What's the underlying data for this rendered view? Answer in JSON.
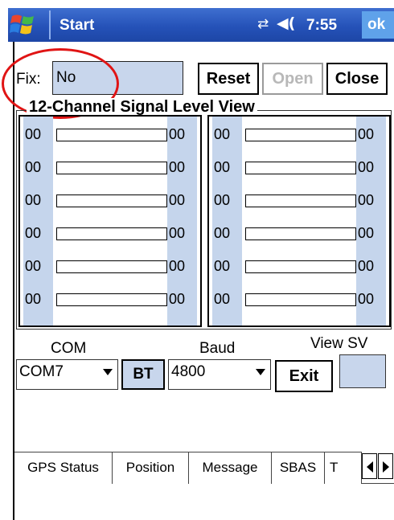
{
  "titlebar": {
    "title": "Start",
    "time": "7:55",
    "ok_label": "ok",
    "connectivity_icon": "connectivity-icon",
    "volume_icon": "volume-icon",
    "logo_icon": "windows-flag-icon"
  },
  "fix": {
    "label": "Fix:",
    "value": "No"
  },
  "buttons": {
    "reset": "Reset",
    "open": "Open",
    "close": "Close"
  },
  "signal_view": {
    "title": "12-Channel Signal Level View",
    "left_channels": [
      {
        "id": "00",
        "level": "00"
      },
      {
        "id": "00",
        "level": "00"
      },
      {
        "id": "00",
        "level": "00"
      },
      {
        "id": "00",
        "level": "00"
      },
      {
        "id": "00",
        "level": "00"
      },
      {
        "id": "00",
        "level": "00"
      }
    ],
    "right_channels": [
      {
        "id": "00",
        "level": "00"
      },
      {
        "id": "00",
        "level": "00"
      },
      {
        "id": "00",
        "level": "00"
      },
      {
        "id": "00",
        "level": "00"
      },
      {
        "id": "00",
        "level": "00"
      },
      {
        "id": "00",
        "level": "00"
      }
    ]
  },
  "controls": {
    "com_label": "COM",
    "com_value": "COM7",
    "bt_label": "BT",
    "baud_label": "Baud",
    "baud_value": "4800",
    "exit_label": "Exit",
    "view_sv_label": "View SV"
  },
  "tabs": [
    "GPS Status",
    "Position",
    "Message",
    "SBAS",
    "T"
  ],
  "colors": {
    "titlebar": "#2552b8",
    "field_fill": "#c8d6ec",
    "highlight_circle": "#e01414",
    "disabled_text": "#b8b8b8"
  }
}
